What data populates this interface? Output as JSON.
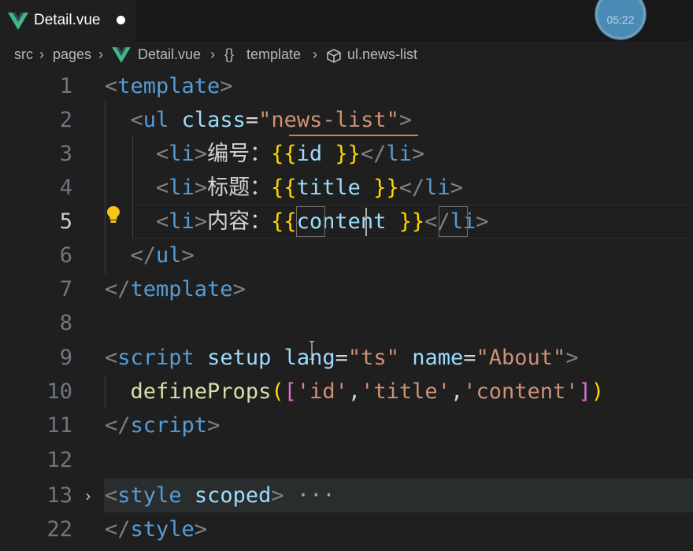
{
  "tab": {
    "title": "Detail.vue"
  },
  "timer": {
    "text": "05:22"
  },
  "breadcrumb": {
    "src": "src",
    "pages": "pages",
    "file": "Detail.vue",
    "template_icon": "{}",
    "template": "template",
    "element": "ul.news-list"
  },
  "colors": {
    "tag": "#569cd6",
    "attr": "#9cdcfe",
    "string": "#ce9178",
    "brace": "#ffd700",
    "vue": "#41b883"
  },
  "lines": [
    {
      "n": "1",
      "t1": "template"
    },
    {
      "n": "2",
      "ul": "ul",
      "cls": "class",
      "val": "\"news-list\""
    },
    {
      "n": "3",
      "li": "li",
      "label": "编号：",
      "var": "id ",
      "li2": "li"
    },
    {
      "n": "4",
      "li": "li",
      "label": "标题：",
      "var": "title ",
      "li2": "li"
    },
    {
      "n": "5",
      "li": "li",
      "label": "内容：",
      "var1": "con",
      "var2": "tent ",
      "li2": "li"
    },
    {
      "n": "6",
      "ul": "ul"
    },
    {
      "n": "7",
      "t1": "template"
    },
    {
      "n": "8"
    },
    {
      "n": "9",
      "script": "script",
      "setup": "setup",
      "lang": "lang",
      "langv": "\"ts\"",
      "name": "name",
      "namev": "\"About\""
    },
    {
      "n": "10",
      "fn": "defineProps",
      "a1": "'id'",
      "a2": "'title'",
      "a3": "'content'"
    },
    {
      "n": "11",
      "script": "script"
    },
    {
      "n": "12"
    },
    {
      "n": "13",
      "style": "style",
      "scoped": "scoped",
      "dots": "···"
    },
    {
      "n": "22",
      "style": "style"
    }
  ]
}
